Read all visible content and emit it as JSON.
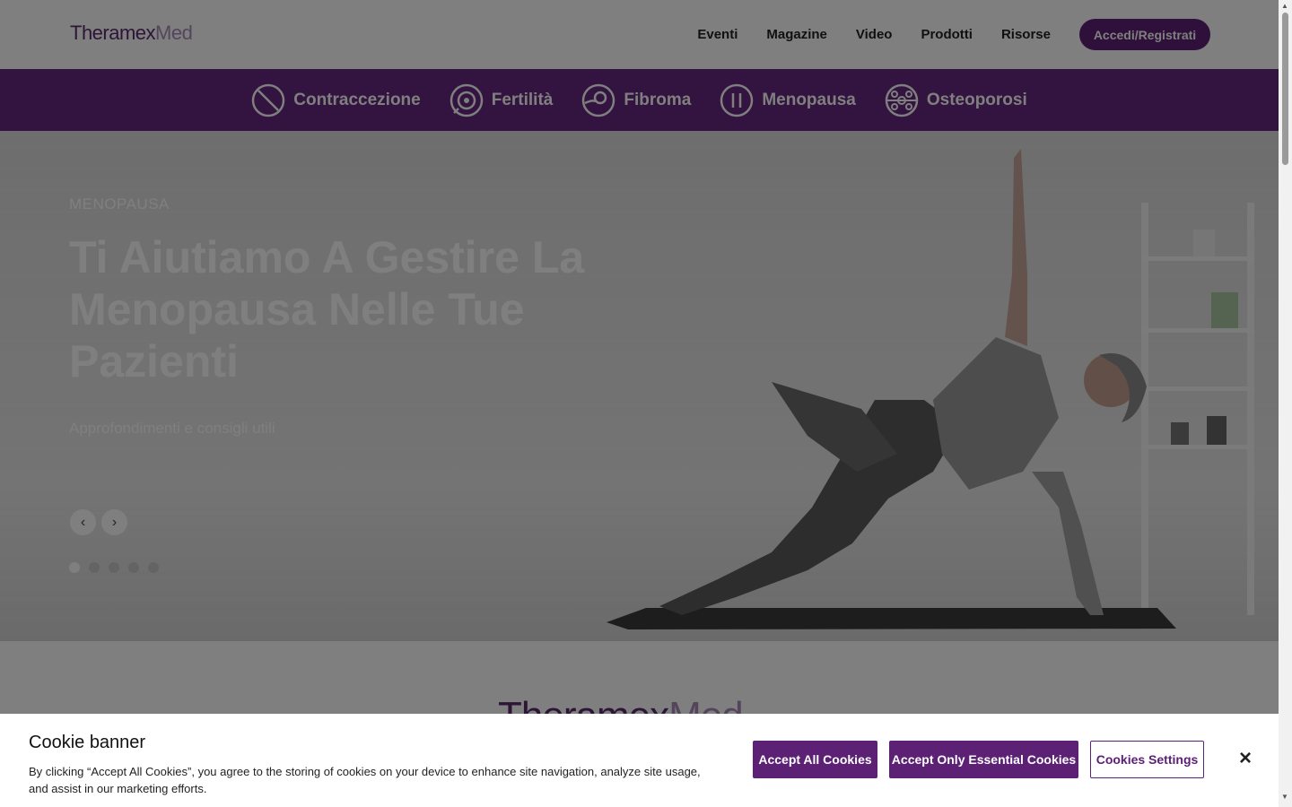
{
  "header": {
    "logo_part1": "Theramex",
    "logo_part2": "Med",
    "nav": [
      "Eventi",
      "Magazine",
      "Video",
      "Prodotti",
      "Risorse"
    ],
    "login_label": "Accedi/Registrati"
  },
  "categories": [
    {
      "label": "Contraccezione",
      "icon": "contraception-icon"
    },
    {
      "label": "Fertilità",
      "icon": "fertility-icon"
    },
    {
      "label": "Fibroma",
      "icon": "fibroid-icon"
    },
    {
      "label": "Menopausa",
      "icon": "menopause-icon"
    },
    {
      "label": "Osteoporosi",
      "icon": "osteoporosis-icon"
    }
  ],
  "hero": {
    "eyebrow": "MENOPAUSA",
    "title": "Ti Aiutiamo A Gestire La Menopausa Nelle Tue Pazienti",
    "subtitle": "Approfondimenti e consigli utili",
    "slide_count": 5,
    "active_slide": 1
  },
  "below": {
    "logo_part1": "Theramex",
    "logo_part2": "Med"
  },
  "cookie": {
    "title": "Cookie banner",
    "text": "By clicking “Accept All Cookies”, you agree to the storing of cookies on your device to enhance site navigation, analyze site usage, and assist in our marketing efforts.",
    "accept_all": "Accept All Cookies",
    "accept_essential": "Accept Only Essential Cookies",
    "settings": "Cookies Settings",
    "close": "×"
  },
  "colors": {
    "brand_purple": "#5c2075",
    "category_bar": "#67267f",
    "logo_dark": "#5a2a6e",
    "logo_light": "#a98bb8"
  }
}
